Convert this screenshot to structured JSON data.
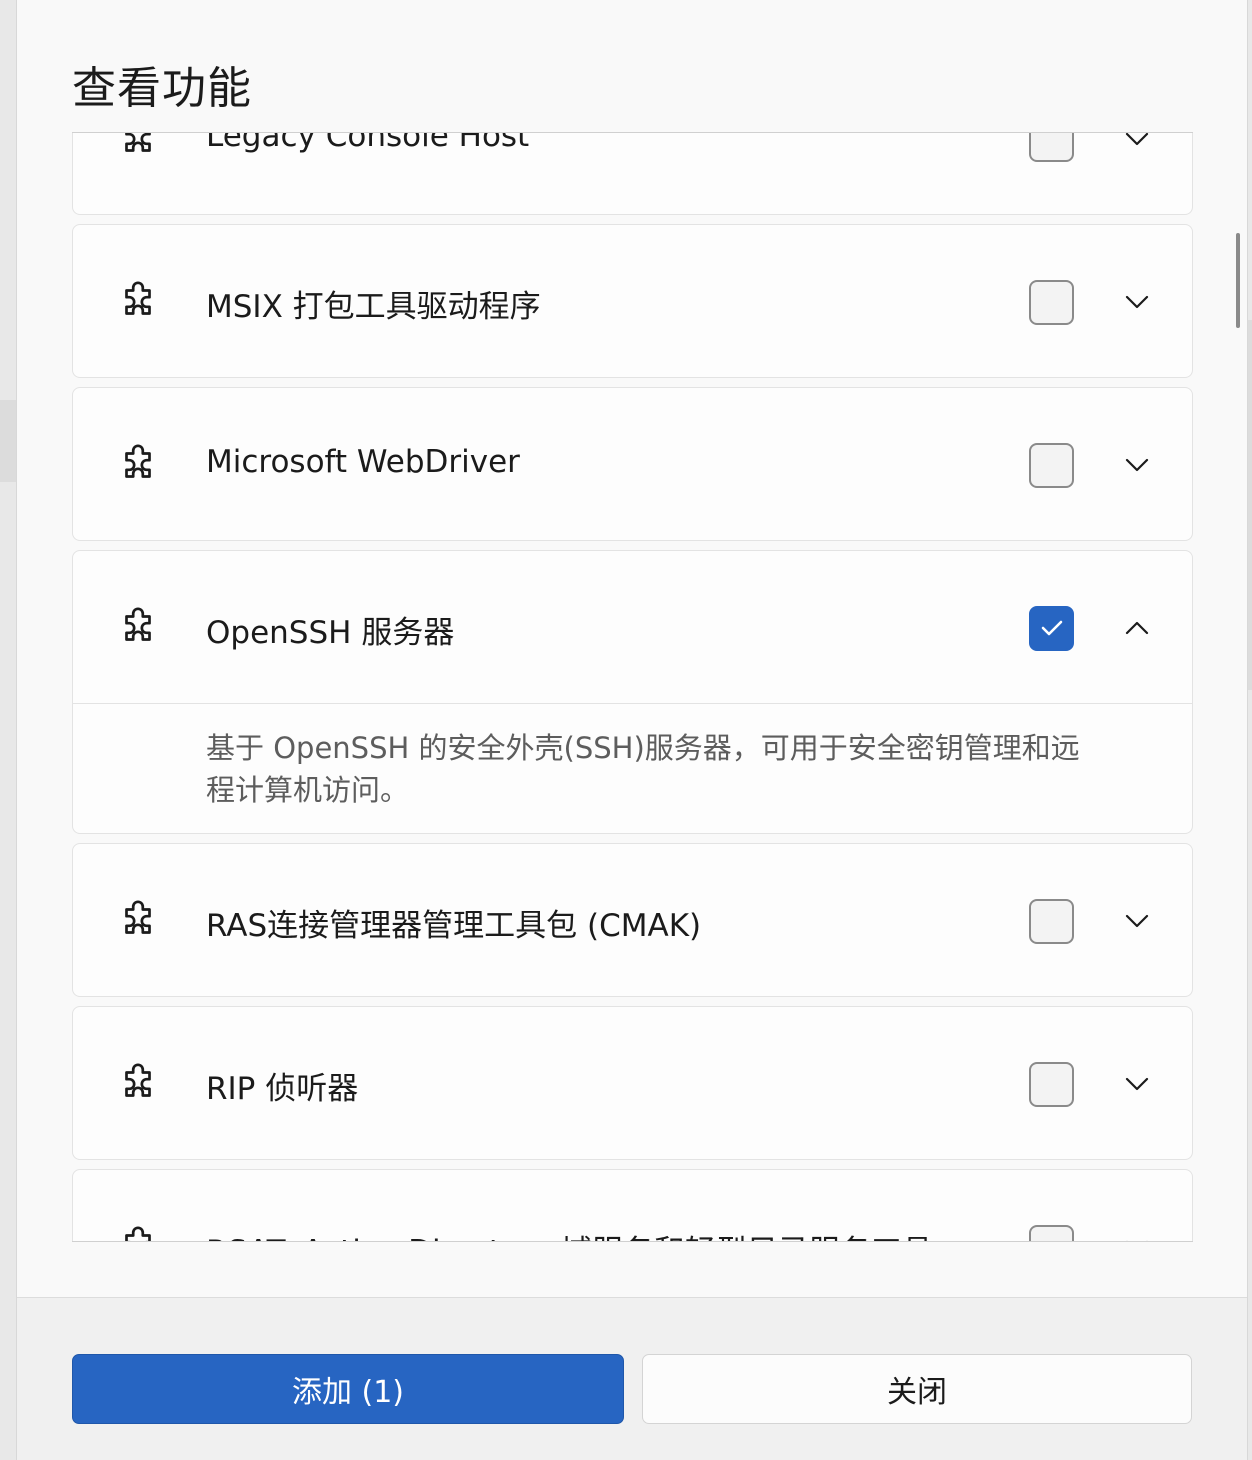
{
  "dialog": {
    "title": "查看功能"
  },
  "features": [
    {
      "name": "Legacy Console Host",
      "checked": false,
      "expanded": false
    },
    {
      "name": "MSIX 打包工具驱动程序",
      "checked": false,
      "expanded": false
    },
    {
      "name": "Microsoft WebDriver",
      "checked": false,
      "expanded": false
    },
    {
      "name": "OpenSSH 服务器",
      "checked": true,
      "expanded": true,
      "description": "基于 OpenSSH 的安全外壳(SSH)服务器，可用于安全密钥管理和远程计算机访问。"
    },
    {
      "name": "RAS连接管理器管理工具包 (CMAK)",
      "checked": false,
      "expanded": false
    },
    {
      "name": "RIP 侦听器",
      "checked": false,
      "expanded": false
    },
    {
      "name": "RSAT: Active Directory 域服务和轻型目录服务工具",
      "checked": false,
      "expanded": false
    }
  ],
  "footer": {
    "add_label": "添加 (1)",
    "close_label": "关闭"
  },
  "icons": {
    "feature": "puzzle-piece-icon",
    "expand": "chevron-down-icon",
    "collapse": "chevron-up-icon",
    "check": "checkmark-icon"
  },
  "colors": {
    "accent": "#2765c2",
    "background": "#f9f9f9",
    "card": "#fdfdfd",
    "description_text": "#5d5d5d"
  }
}
